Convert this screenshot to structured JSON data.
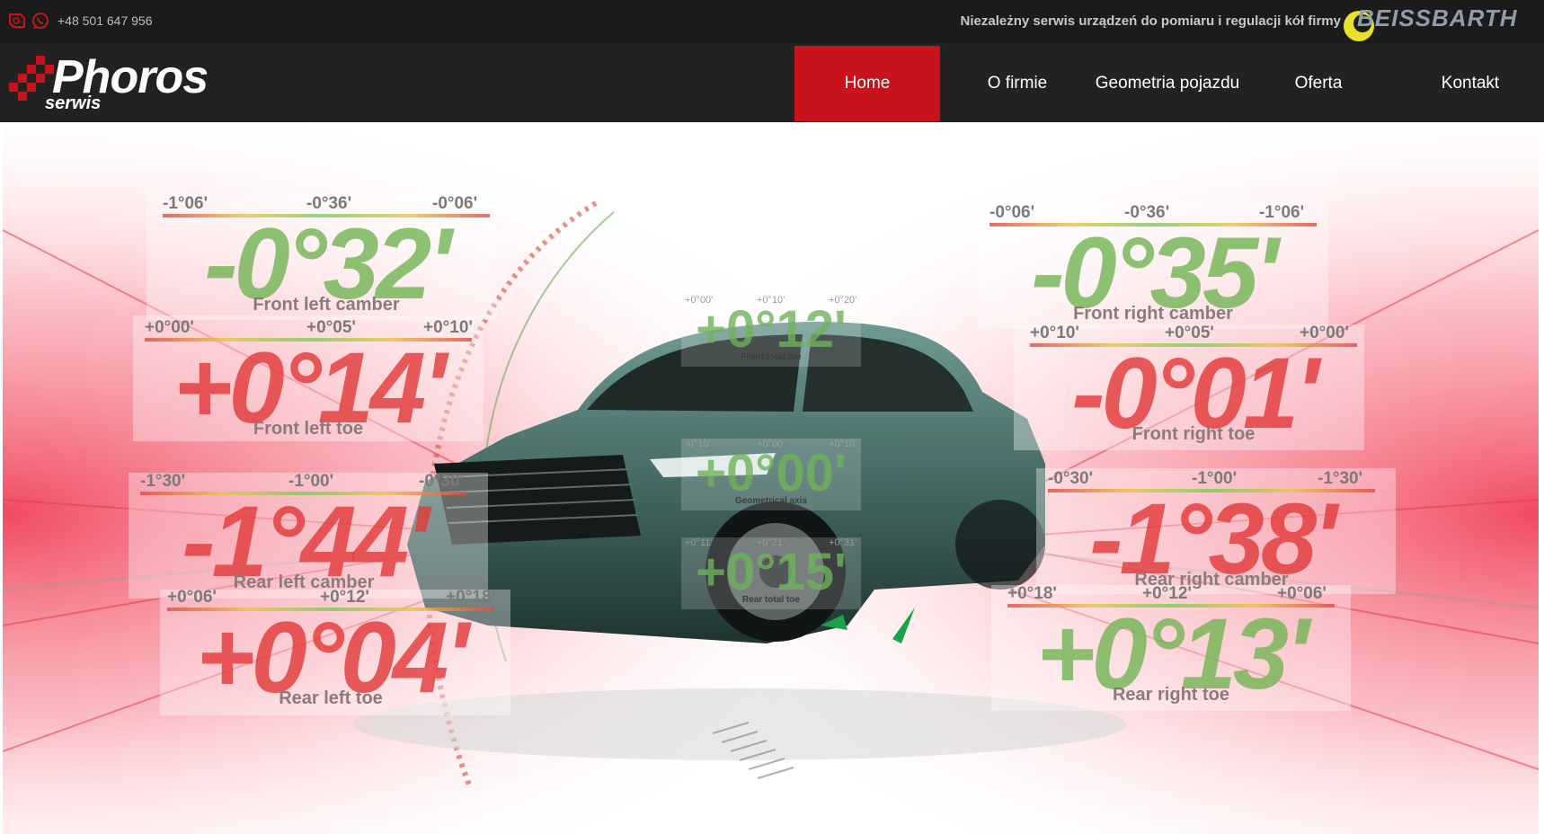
{
  "topbar": {
    "phone": "+48 501 647 956",
    "tagline": "Niezależny serwis urządzeń do pomiaru i regulacji kół firmy",
    "partner": "BEISSBARTH",
    "icons": [
      "viber-icon",
      "whatsapp-icon"
    ]
  },
  "logo": {
    "brand": "Phoros",
    "sub": "serwis"
  },
  "nav": [
    {
      "label": "Home",
      "active": true
    },
    {
      "label": "O firmie",
      "active": false
    },
    {
      "label": "Geometria pojazdu",
      "active": false
    },
    {
      "label": "Oferta",
      "active": false
    },
    {
      "label": "Kontakt",
      "active": false
    }
  ],
  "hero": {
    "panels": {
      "front_left_camber": {
        "value": "-0°32'",
        "caption": "Front left camber",
        "scale": [
          "-1°06'",
          "-0°36'",
          "-0°06'"
        ]
      },
      "front_left_toe": {
        "value": "+0°14'",
        "caption": "Front left toe",
        "scale": [
          "+0°00'",
          "+0°05'",
          "+0°10'"
        ]
      },
      "rear_left_camber": {
        "value": "-1°44'",
        "caption": "Rear left camber",
        "scale": [
          "-1°30'",
          "-1°00'",
          "-0°30'"
        ]
      },
      "rear_left_toe": {
        "value": "+0°04'",
        "caption": "Rear left toe",
        "scale": [
          "+0°06'",
          "+0°12'",
          "+0°18'"
        ]
      },
      "front_right_camber": {
        "value": "-0°35'",
        "caption": "Front right camber",
        "scale": [
          "-0°06'",
          "-0°36'",
          "-1°06'"
        ]
      },
      "front_right_toe": {
        "value": "-0°01'",
        "caption": "Front right toe",
        "scale": [
          "+0°10'",
          "+0°05'",
          "+0°00'"
        ]
      },
      "rear_right_camber": {
        "value": "-1°38'",
        "caption": "Rear right camber",
        "scale": [
          "-0°30'",
          "-1°00'",
          "-1°30'"
        ]
      },
      "rear_right_toe": {
        "value": "+0°13'",
        "caption": "Rear right toe",
        "scale": [
          "+0°18'",
          "+0°12'",
          "+0°06'"
        ]
      },
      "front_total_toe": {
        "value": "+0°12'",
        "caption": "Front total toe",
        "scale": [
          "+0°00'",
          "+0°10'",
          "+0°20'"
        ]
      },
      "geometrical_axis": {
        "value": "+0°00'",
        "caption": "Geometrical axis",
        "scale": [
          "-0°10'",
          "+0°00'",
          "+0°10'"
        ]
      },
      "rear_total_toe": {
        "value": "+0°15'",
        "caption": "Rear total toe",
        "scale": [
          "+0°11'",
          "+0°21'",
          "+0°31'"
        ]
      }
    }
  },
  "colors": {
    "accent": "#c8131c",
    "topbar": "#1b1b1b",
    "header": "#222222"
  }
}
